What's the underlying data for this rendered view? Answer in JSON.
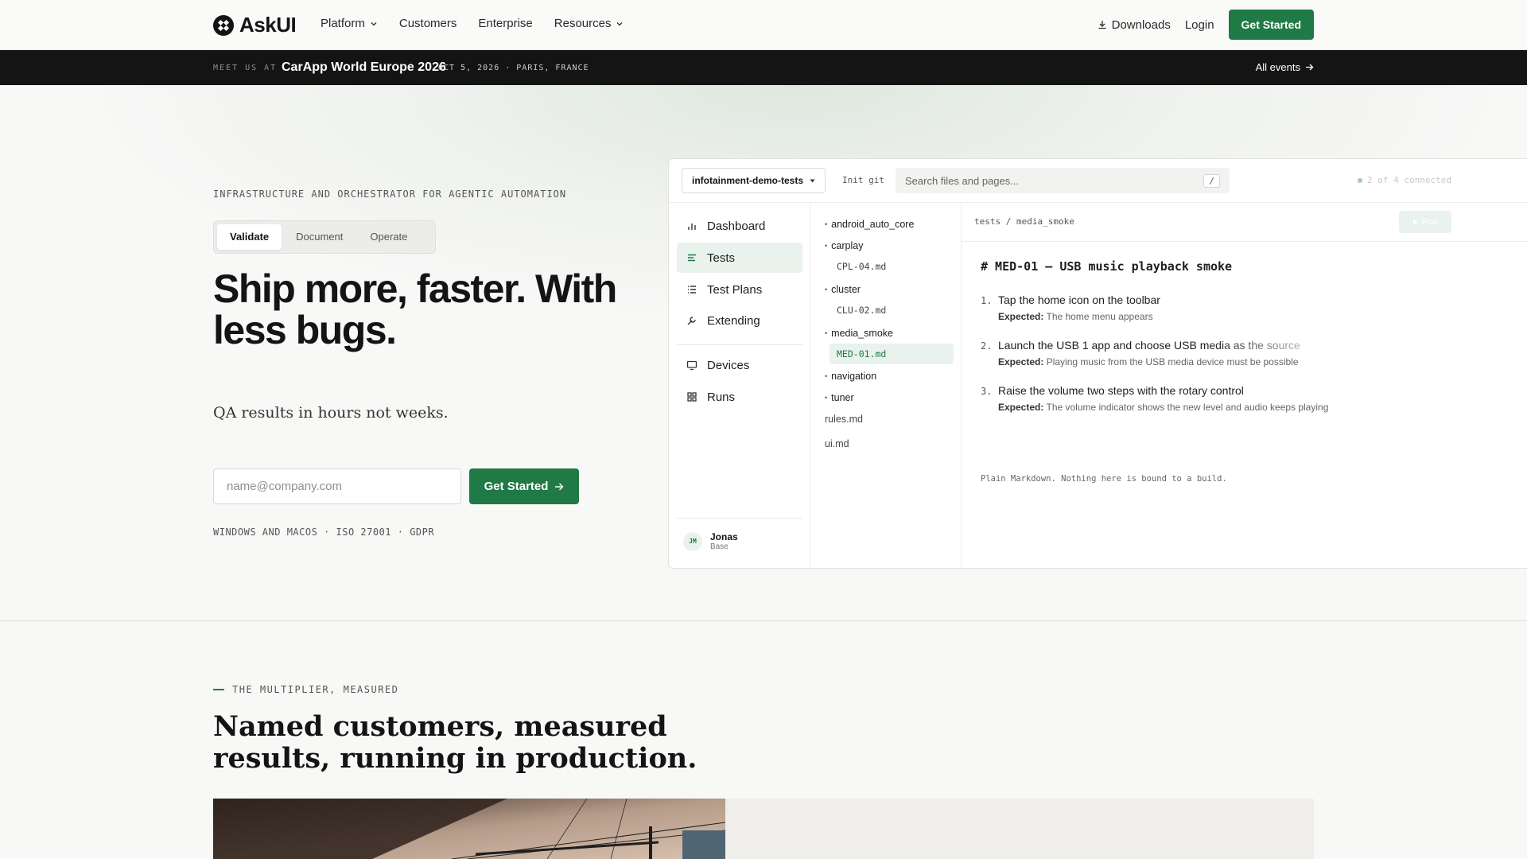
{
  "nav": {
    "brand": "AskUI",
    "links": [
      {
        "label": "Platform",
        "dropdown": true
      },
      {
        "label": "Customers",
        "dropdown": false
      },
      {
        "label": "Enterprise",
        "dropdown": false
      },
      {
        "label": "Resources",
        "dropdown": true
      }
    ],
    "downloads": "Downloads",
    "login": "Login",
    "cta": "Get Started"
  },
  "event": {
    "meet": "MEET US AT",
    "title": "CarApp World Europe 2026",
    "date": "OCT 5, 2026 · PARIS, FRANCE",
    "all": "All events"
  },
  "hero": {
    "eyebrow": "INFRASTRUCTURE AND ORCHESTRATOR FOR AGENTIC AUTOMATION",
    "tabs": [
      "Validate",
      "Document",
      "Operate"
    ],
    "active_tab": "Validate",
    "headline": "Ship more, faster. With less bugs.",
    "sub": "QA results in hours not weeks.",
    "email_placeholder": "name@company.com",
    "cta": "Get Started",
    "compliance": "WINDOWS AND MACOS · ISO 27001 · GDPR"
  },
  "app": {
    "repo": "infotainment-demo-tests",
    "init_git": "Init git",
    "search_placeholder": "Search files and pages...",
    "search_kbd": "/",
    "connected": "2 of 4 connected",
    "sidebar": {
      "items": [
        {
          "label": "Dashboard",
          "icon": "bar-chart-icon"
        },
        {
          "label": "Tests",
          "icon": "list-icon",
          "active": true
        },
        {
          "label": "Test Plans",
          "icon": "checklist-icon"
        },
        {
          "label": "Extending",
          "icon": "wrench-icon"
        },
        {
          "label": "Devices",
          "icon": "monitor-icon"
        },
        {
          "label": "Runs",
          "icon": "grid-icon"
        }
      ],
      "user": {
        "initials": "JM",
        "name": "Jonas",
        "plan": "Base"
      }
    },
    "tree": {
      "android_auto_core": "android_auto_core",
      "carplay": "carplay",
      "cpl": "CPL-04.md",
      "cluster": "cluster",
      "clu": "CLU-02.md",
      "media_smoke": "media_smoke",
      "med": "MED-01.md",
      "navigation": "navigation",
      "tuner": "tuner",
      "rules": "rules.md",
      "ui": "ui.md"
    },
    "editor": {
      "breadcrumb": "tests / media_smoke",
      "run": "Run",
      "heading": "# MED-01 — USB music playback smoke",
      "expected_label": "Expected:",
      "steps": [
        {
          "n": "1.",
          "text": "Tap the home icon on the toolbar",
          "expected": "The home menu appears"
        },
        {
          "n": "2.",
          "text": "Launch the USB 1 app and choose USB media as the source",
          "expected": "Playing music from the USB media device must be possible"
        },
        {
          "n": "3.",
          "text": "Raise the volume two steps with the rotary control",
          "expected": "The volume indicator shows the new level and audio keeps playing"
        }
      ],
      "note": "Plain Markdown. Nothing here is bound to a build."
    }
  },
  "section": {
    "eyebrow": "THE MULTIPLIER, MEASURED",
    "heading": "Named customers, measured results, running in production."
  },
  "colors": {
    "accent": "#1f7a45",
    "dark": "#141414",
    "active_bg": "#e9f2ec"
  }
}
